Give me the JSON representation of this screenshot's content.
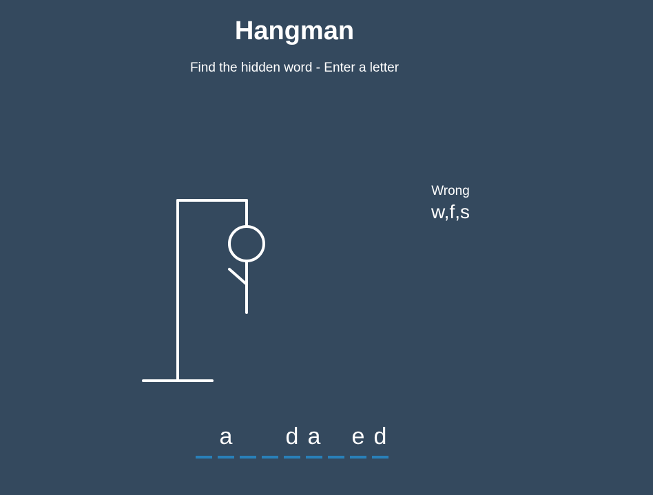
{
  "header": {
    "title": "Hangman",
    "subtitle": "Find the hidden word - Enter a letter"
  },
  "wrong": {
    "label": "Wrong",
    "letters": "w,f,s"
  },
  "word": {
    "slots": [
      "",
      "a",
      "",
      "",
      "d",
      "a",
      "",
      "e",
      "d"
    ]
  },
  "figure": {
    "parts_shown": [
      "head",
      "body",
      "left-arm"
    ]
  },
  "colors": {
    "background": "#34495e",
    "underline": "#2980b9",
    "foreground": "#ffffff"
  }
}
